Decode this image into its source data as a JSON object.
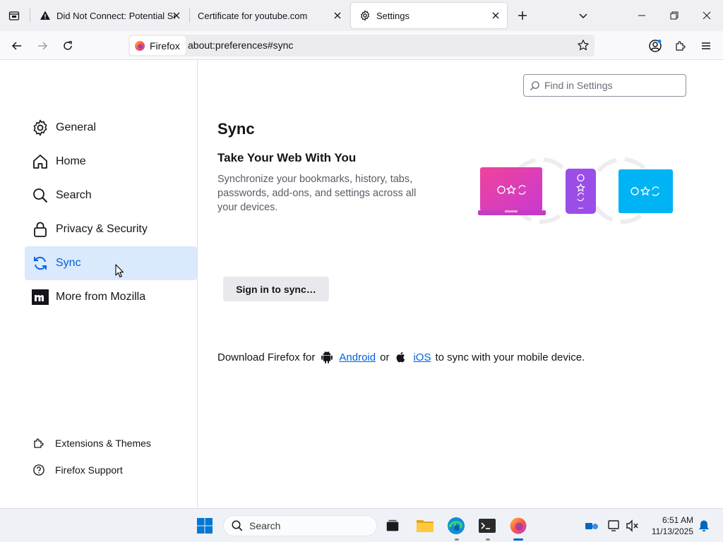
{
  "browser": {
    "tabs": [
      {
        "title": "Did Not Connect: Potential Security Issue",
        "icon": "warning-icon",
        "active": false
      },
      {
        "title": "Certificate for youtube.com",
        "icon": "",
        "active": false
      },
      {
        "title": "Settings",
        "icon": "gear-icon",
        "active": true
      }
    ],
    "identity_label": "Firefox",
    "url": "about:preferences#sync"
  },
  "sidebar": {
    "categories": [
      {
        "label": "General",
        "icon": "gear-icon"
      },
      {
        "label": "Home",
        "icon": "home-icon"
      },
      {
        "label": "Search",
        "icon": "search-icon"
      },
      {
        "label": "Privacy & Security",
        "icon": "lock-icon"
      },
      {
        "label": "Sync",
        "icon": "sync-icon",
        "selected": true
      },
      {
        "label": "More from Mozilla",
        "icon": "mozilla-icon"
      }
    ],
    "links": [
      {
        "label": "Extensions & Themes",
        "icon": "puzzle-icon"
      },
      {
        "label": "Firefox Support",
        "icon": "help-icon"
      }
    ]
  },
  "main": {
    "search_placeholder": "Find in Settings",
    "page_title": "Sync",
    "subtitle": "Take Your Web With You",
    "description": "Synchronize your bookmarks, history, tabs, passwords, add-ons, and settings across all your devices.",
    "signin_button": "Sign in to sync…",
    "download": {
      "prefix": "Download Firefox for",
      "android": "Android",
      "or": "or",
      "ios": "iOS",
      "suffix": "to sync with your mobile device."
    }
  },
  "taskbar": {
    "search_label": "Search",
    "time": "6:51 AM",
    "date": "11/13/2025"
  },
  "colors": {
    "accent": "#0061e0",
    "selected_bg": "#dae9fb",
    "laptop_pink": "#e0389e",
    "phone_purple": "#9b4de8",
    "tablet_cyan": "#00b3f4"
  }
}
